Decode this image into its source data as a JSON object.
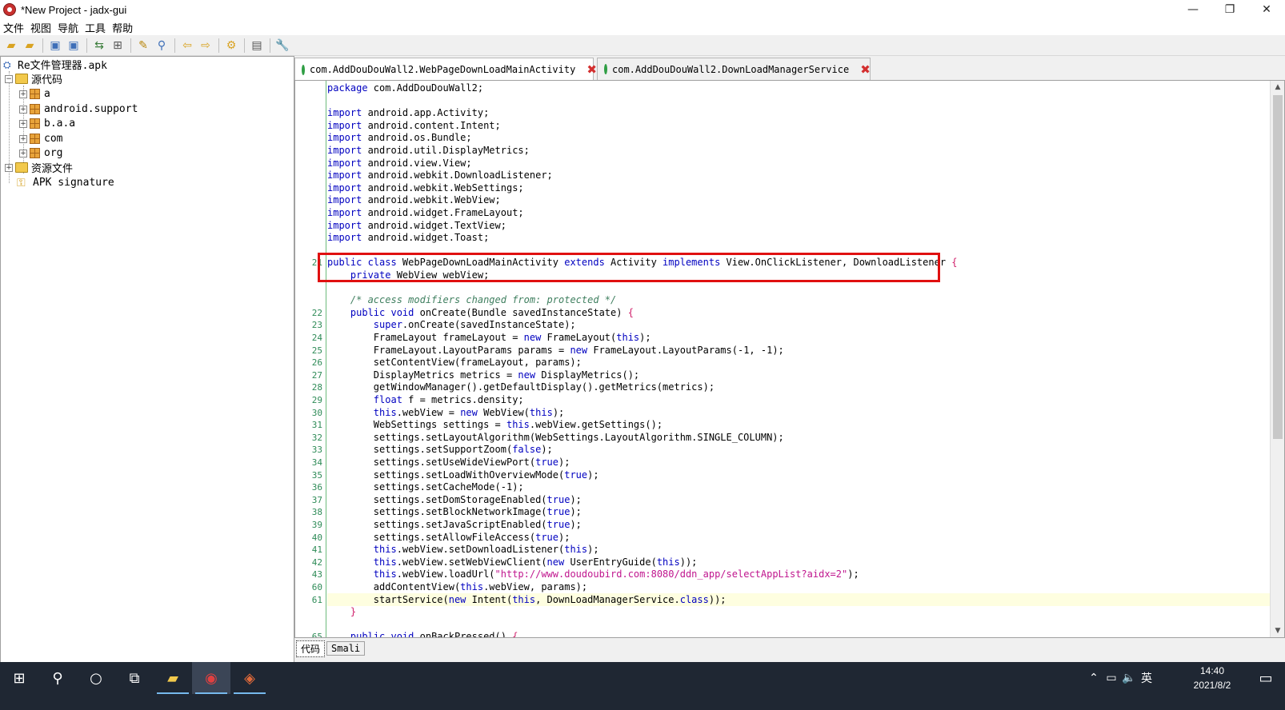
{
  "window": {
    "title": "*New Project - jadx-gui",
    "min_icon": "—",
    "restore_icon": "❐",
    "close_icon": "✕"
  },
  "menu": [
    "文件",
    "视图",
    "导航",
    "工具",
    "帮助"
  ],
  "tree": {
    "root": "Re文件管理器.apk",
    "source": "源代码",
    "packages": [
      "a",
      "android.support",
      "b.a.a",
      "com",
      "org"
    ],
    "resources": "资源文件",
    "signature": "APK signature"
  },
  "tabs": [
    {
      "label": "com.AddDouDouWall2.WebPageDownLoadMainActivity",
      "active": true
    },
    {
      "label": "com.AddDouDouWall2.DownLoadManagerService",
      "active": false
    }
  ],
  "code": {
    "lines": [
      {
        "n": "",
        "html": "<span class=\"kw\">package</span> com.AddDouDouWall2;"
      },
      {
        "n": "",
        "html": ""
      },
      {
        "n": "",
        "html": "<span class=\"kw\">import</span> android.app.Activity;"
      },
      {
        "n": "",
        "html": "<span class=\"kw\">import</span> android.content.Intent;"
      },
      {
        "n": "",
        "html": "<span class=\"kw\">import</span> android.os.Bundle;"
      },
      {
        "n": "",
        "html": "<span class=\"kw\">import</span> android.util.DisplayMetrics;"
      },
      {
        "n": "",
        "html": "<span class=\"kw\">import</span> android.view.View;"
      },
      {
        "n": "",
        "html": "<span class=\"kw\">import</span> android.webkit.DownloadListener;"
      },
      {
        "n": "",
        "html": "<span class=\"kw\">import</span> android.webkit.WebSettings;"
      },
      {
        "n": "",
        "html": "<span class=\"kw\">import</span> android.webkit.WebView;"
      },
      {
        "n": "",
        "html": "<span class=\"kw\">import</span> android.widget.FrameLayout;"
      },
      {
        "n": "",
        "html": "<span class=\"kw\">import</span> android.widget.TextView;"
      },
      {
        "n": "",
        "html": "<span class=\"kw\">import</span> android.widget.Toast;"
      },
      {
        "n": "",
        "html": ""
      },
      {
        "n": "21",
        "html": "<span class=\"kw\">public class</span> WebPageDownLoadMainActivity <span class=\"kw\">extends</span> Activity <span class=\"kw\">implements</span> View.OnClickListener, DownloadListener <span class=\"pn\">{</span>"
      },
      {
        "n": "",
        "html": "    <span class=\"kw\">private</span> WebView webView;"
      },
      {
        "n": "",
        "html": ""
      },
      {
        "n": "",
        "html": "    <span class=\"cm\">/* access modifiers changed from: protected */</span>"
      },
      {
        "n": "22",
        "html": "    <span class=\"kw\">public void</span> onCreate(Bundle savedInstanceState) <span class=\"pn\">{</span>"
      },
      {
        "n": "23",
        "html": "        <span class=\"kw\">super</span>.onCreate(savedInstanceState);"
      },
      {
        "n": "24",
        "html": "        FrameLayout frameLayout = <span class=\"kw\">new</span> FrameLayout(<span class=\"kw\">this</span>);"
      },
      {
        "n": "25",
        "html": "        FrameLayout.LayoutParams params = <span class=\"kw\">new</span> FrameLayout.LayoutParams(-1, -1);"
      },
      {
        "n": "26",
        "html": "        setContentView(frameLayout, params);"
      },
      {
        "n": "27",
        "html": "        DisplayMetrics metrics = <span class=\"kw\">new</span> DisplayMetrics();"
      },
      {
        "n": "28",
        "html": "        getWindowManager().getDefaultDisplay().getMetrics(metrics);"
      },
      {
        "n": "29",
        "html": "        <span class=\"kw\">float</span> f = metrics.density;"
      },
      {
        "n": "30",
        "html": "        <span class=\"kw\">this</span>.webView = <span class=\"kw\">new</span> WebView(<span class=\"kw\">this</span>);"
      },
      {
        "n": "31",
        "html": "        WebSettings settings = <span class=\"kw\">this</span>.webView.getSettings();"
      },
      {
        "n": "32",
        "html": "        settings.setLayoutAlgorithm(WebSettings.LayoutAlgorithm.SINGLE_COLUMN);"
      },
      {
        "n": "33",
        "html": "        settings.setSupportZoom(<span class=\"kw\">false</span>);"
      },
      {
        "n": "34",
        "html": "        settings.setUseWideViewPort(<span class=\"kw\">true</span>);"
      },
      {
        "n": "35",
        "html": "        settings.setLoadWithOverviewMode(<span class=\"kw\">true</span>);"
      },
      {
        "n": "36",
        "html": "        settings.setCacheMode(-1);"
      },
      {
        "n": "37",
        "html": "        settings.setDomStorageEnabled(<span class=\"kw\">true</span>);"
      },
      {
        "n": "38",
        "html": "        settings.setBlockNetworkImage(<span class=\"kw\">true</span>);"
      },
      {
        "n": "39",
        "html": "        settings.setJavaScriptEnabled(<span class=\"kw\">true</span>);"
      },
      {
        "n": "40",
        "html": "        settings.setAllowFileAccess(<span class=\"kw\">true</span>);"
      },
      {
        "n": "41",
        "html": "        <span class=\"kw\">this</span>.webView.setDownloadListener(<span class=\"kw\">this</span>);"
      },
      {
        "n": "42",
        "html": "        <span class=\"kw\">this</span>.webView.setWebViewClient(<span class=\"kw\">new</span> UserEntryGuide(<span class=\"kw\">this</span>));"
      },
      {
        "n": "43",
        "html": "        <span class=\"kw\">this</span>.webView.loadUrl(<span class=\"st\">\"http://www.doudoubird.com:8080/ddn_app/selectAppList?aidx=2\"</span>);"
      },
      {
        "n": "60",
        "html": "        addContentView(<span class=\"kw\">this</span>.webView, params);"
      },
      {
        "n": "61",
        "html": "        startService(<span class=\"kw\">new</span> Intent(<span class=\"kw\">this</span>, DownLoadManagerService.<span class=\"kw\">class</span>));"
      },
      {
        "n": "",
        "html": "    <span class=\"pn\">}</span>"
      },
      {
        "n": "",
        "html": ""
      },
      {
        "n": "65",
        "html": "    <span class=\"kw\">public void</span> onBackPressed() <span class=\"pn\">{</span>"
      }
    ],
    "highlight_line": "61"
  },
  "bottom_tabs": [
    "代码",
    "Smali"
  ],
  "taskbar": {
    "time": "14:40",
    "date": "2021/8/2",
    "ime": "英"
  },
  "colors": {
    "keyword": "#0000c0",
    "comment": "#3f7f5f",
    "string": "#c0168e",
    "line_number": "#2e8b57",
    "highlight": "#fefee0",
    "annotation_box": "#e01010"
  }
}
